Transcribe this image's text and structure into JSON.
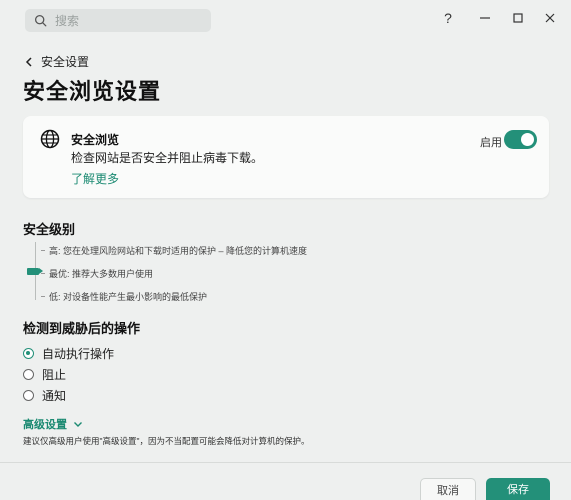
{
  "search": {
    "placeholder": "搜索"
  },
  "window": {
    "help_icon": "?",
    "minimize_icon": "—",
    "maximize_icon": "☐",
    "close_icon": "✕"
  },
  "breadcrumb": {
    "back_label": "安全设置"
  },
  "page": {
    "title": "安全浏览设置"
  },
  "card": {
    "title": "安全浏览",
    "description": "检查网站是否安全并阻止病毒下载。",
    "link": "了解更多",
    "toggle_label": "启用",
    "toggle_on": true
  },
  "security_level": {
    "title": "安全级别",
    "levels": [
      {
        "label": "高: 您在处理风险网站和下载时适用的保护 – 降低您的计算机速度"
      },
      {
        "label": "最优: 推荐大多数用户使用"
      },
      {
        "label": "低: 对设备性能产生最小影响的最低保护"
      }
    ],
    "selected": "最优"
  },
  "threat_action": {
    "title": "检测到威胁后的操作",
    "options": [
      {
        "label": "自动执行操作",
        "selected": true
      },
      {
        "label": "阻止",
        "selected": false
      },
      {
        "label": "通知",
        "selected": false
      }
    ]
  },
  "advanced": {
    "link": "高级设置",
    "note": "建议仅高级用户使用\"高级设置\"，因为不当配置可能会降低对计算机的保护。"
  },
  "footer": {
    "cancel_label": "取消",
    "save_label": "保存"
  },
  "colors": {
    "accent": "#239079",
    "link": "#1b8a72",
    "background": "#eef0ef",
    "card": "#fafbfa"
  }
}
